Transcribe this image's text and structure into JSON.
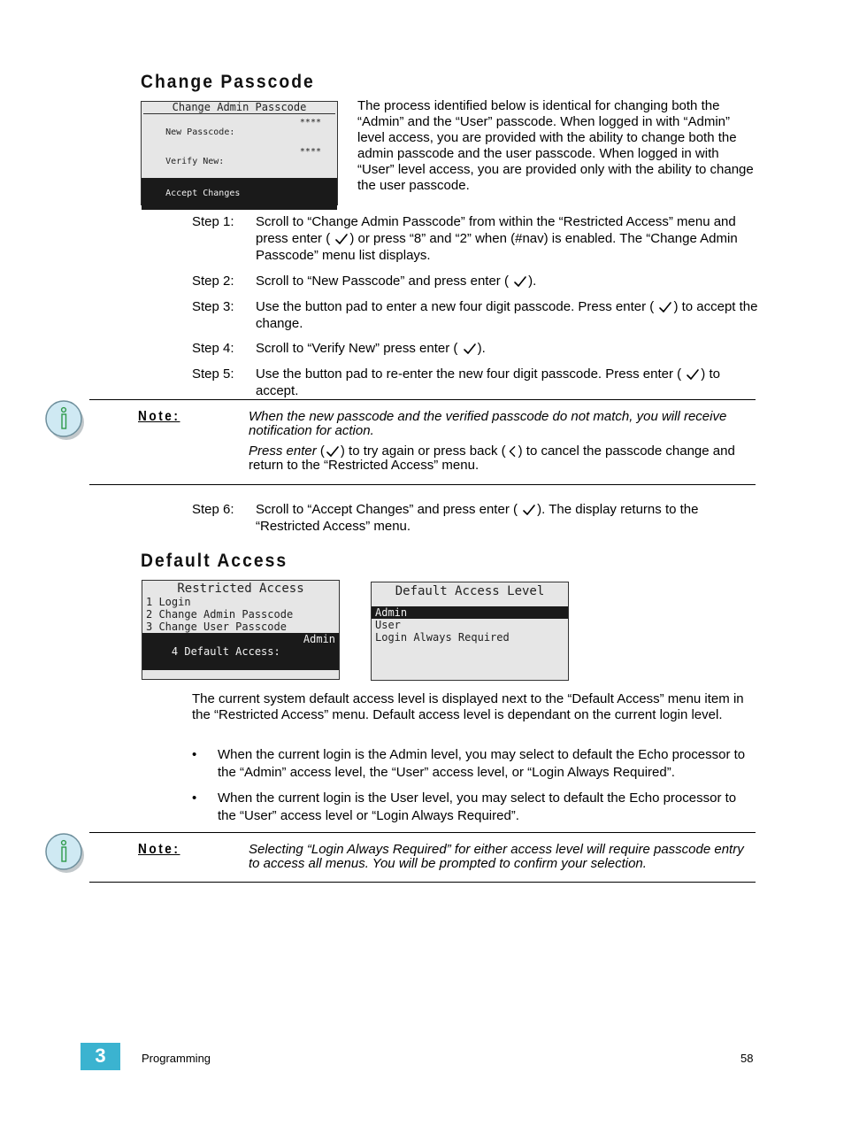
{
  "section1": {
    "heading": "Change Passcode",
    "lcd": {
      "title": "Change Admin Passcode",
      "rows": [
        {
          "label": "New Passcode:",
          "value": "****",
          "selected": false
        },
        {
          "label": "Verify New:",
          "value": "****",
          "selected": false
        },
        {
          "label": "Accept Changes",
          "value": "",
          "selected": true
        }
      ]
    },
    "intro": "The process identified below is identical for changing both the “Admin” and the “User” passcode. When logged in with “Admin” level access, you are provided with the ability to change both the admin passcode and the user passcode. When logged in with “User” level access, you are provided only with the ability to change the user passcode.",
    "steps": [
      {
        "label": "Step 1:",
        "before": "Scroll to “Change Admin Passcode” from within the “Restricted Access” menu and press enter (",
        "after": ") or press “8” and “2” when (#nav) is enabled. The “Change Admin Passcode” menu list displays."
      },
      {
        "label": "Step 2:",
        "before": "Scroll to “New Passcode” and press enter (",
        "after": ")."
      },
      {
        "label": "Step 3:",
        "before": "Use the button pad to enter a new four digit passcode. Press enter (",
        "after": ") to accept the change."
      },
      {
        "label": "Step 4:",
        "before": "Scroll to “Verify New” press enter (",
        "after": ")."
      },
      {
        "label": "Step 5:",
        "before": "Use the button pad to re-enter the new four digit passcode. Press enter (",
        "after": ") to accept."
      }
    ],
    "note": {
      "label": "Note:",
      "para1": "When the new passcode and the verified passcode do not match, you will receive notification for action.",
      "para2_italic": "Press enter",
      "para2_mid": ") to try again or press back (",
      "para2_end": ") to cancel the passcode change and return to the “Restricted Access” menu."
    },
    "step6": {
      "label": "Step 6:",
      "before": "Scroll to “Accept Changes” and press enter (",
      "after": "). The display returns to the “Restricted Access” menu."
    }
  },
  "section2": {
    "heading": "Default Access",
    "lcd1": {
      "title": "Restricted Access",
      "rows": [
        {
          "label": "1 Login",
          "value": "",
          "selected": false
        },
        {
          "label": "2 Change Admin Passcode",
          "value": "",
          "selected": false
        },
        {
          "label": "3 Change User Passcode",
          "value": "",
          "selected": false
        },
        {
          "label": "4 Default Access:",
          "value": "Admin",
          "selected": true
        }
      ]
    },
    "lcd2": {
      "title": "Default Access Level",
      "rows": [
        {
          "label": "Admin",
          "selected": true
        },
        {
          "label": "User",
          "selected": false
        },
        {
          "label": "Login Always Required",
          "selected": false
        }
      ]
    },
    "paragraph": "The current system default access level is displayed next to the “Default Access” menu item in the “Restricted Access” menu. Default access level is dependant on the current login level.",
    "bullets": [
      "When the current login is the Admin level, you may select to default the Echo processor to the “Admin” access level, the “User” access level, or “Login Always Required”.",
      "When the current login is the User level, you may select to default the Echo processor to the “User” access level or “Login Always Required”."
    ],
    "bullet_char": "•",
    "note": {
      "label": "Note:",
      "text": "Selecting “Login Always Required” for either access level will require passcode entry to access all menus. You will be prompted to confirm your selection."
    }
  },
  "footer": {
    "chapter_number": "3",
    "chapter_title": "Programming",
    "page_number": "58",
    "chapter_color": "#3bb3d0"
  },
  "icons": {
    "enter": "check-icon",
    "back": "back-chevron-icon",
    "note": "info-icon"
  }
}
